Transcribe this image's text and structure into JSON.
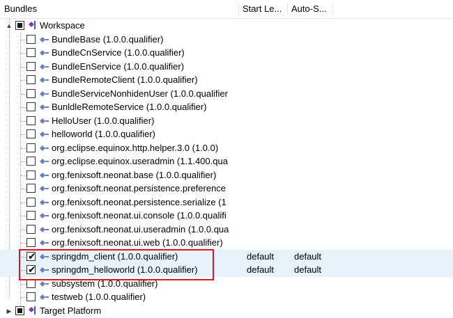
{
  "columns": {
    "bundles": "Bundles",
    "start_level": "Start Le...",
    "auto_start": "Auto-S..."
  },
  "workspace": {
    "label": "Workspace",
    "expander": "▲"
  },
  "bundles": [
    {
      "label": "BundleBase (1.0.0.qualifier)",
      "checked": false
    },
    {
      "label": "BundleCnService (1.0.0.qualifier)",
      "checked": false
    },
    {
      "label": "BundleEnService (1.0.0.qualifier)",
      "checked": false
    },
    {
      "label": "BundleRemoteClient (1.0.0.qualifier)",
      "checked": false
    },
    {
      "label": "BundleServiceNonhidenUser (1.0.0.qualifier",
      "checked": false
    },
    {
      "label": "BunldleRemoteService (1.0.0.qualifier)",
      "checked": false
    },
    {
      "label": "HelloUser (1.0.0.qualifier)",
      "checked": false
    },
    {
      "label": "helloworld (1.0.0.qualifier)",
      "checked": false
    },
    {
      "label": "org.eclipse.equinox.http.helper.3.0 (1.0.0)",
      "checked": false
    },
    {
      "label": "org.eclipse.equinox.useradmin (1.1.400.qua",
      "checked": false
    },
    {
      "label": "org.fenixsoft.neonat.base (1.0.0.qualifier)",
      "checked": false
    },
    {
      "label": "org.fenixsoft.neonat.persistence.preference",
      "checked": false
    },
    {
      "label": "org.fenixsoft.neonat.persistence.serialize (1",
      "checked": false
    },
    {
      "label": "org.fenixsoft.neonat.ui.console (1.0.0.qualifi",
      "checked": false
    },
    {
      "label": "org.fenixsoft.neonat.ui.useradmin (1.0.0.qua",
      "checked": false
    },
    {
      "label": "org.fenixsoft.neonat.ui.web (1.0.0.qualifier)",
      "checked": false
    },
    {
      "label": "springdm_client (1.0.0.qualifier)",
      "checked": true,
      "start_level": "default",
      "auto_start": "default",
      "tick": "✔"
    },
    {
      "label": "springdm_helloworld (1.0.0.qualifier)",
      "checked": true,
      "start_level": "default",
      "auto_start": "default",
      "tick": "✔"
    },
    {
      "label": "subsystem (1.0.0.qualifier)",
      "checked": false
    },
    {
      "label": "testweb (1.0.0.qualifier)",
      "checked": false
    }
  ],
  "target_platform": {
    "label": "Target Platform",
    "expander": "▶"
  },
  "colors": {
    "highlight_border": "#e0141e",
    "selected_row": "#e8f2fb",
    "workspace_icon_purple": "#8a3aa8",
    "workspace_icon_blue": "#2b63c9",
    "bundle_icon": "#6b7fbf"
  }
}
